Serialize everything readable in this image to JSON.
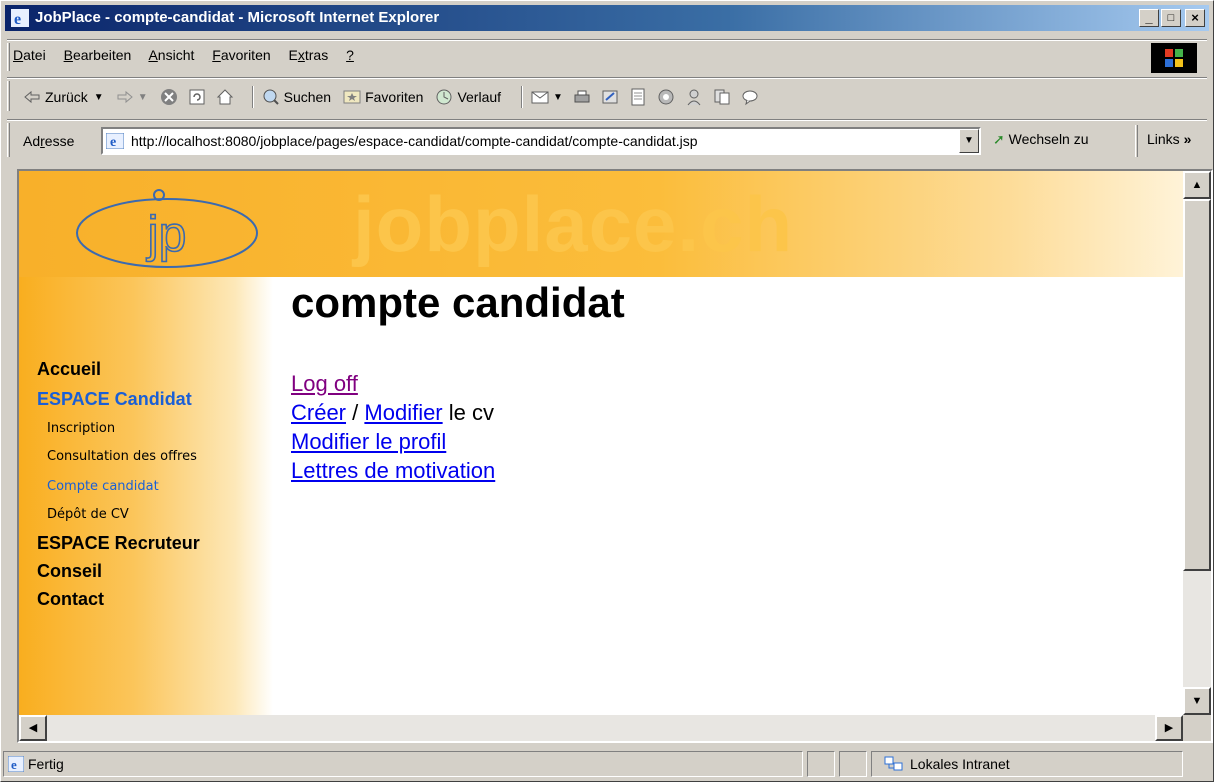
{
  "window": {
    "title": "JobPlace - compte-candidat - Microsoft Internet Explorer",
    "minimize": "_",
    "maximize": "□",
    "close": "×"
  },
  "menu": {
    "items": [
      {
        "label": "Datei",
        "u": "D",
        "rest": "atei"
      },
      {
        "label": "Bearbeiten",
        "u": "B",
        "rest": "earbeiten"
      },
      {
        "label": "Ansicht",
        "u": "A",
        "rest": "nsicht"
      },
      {
        "label": "Favoriten",
        "u": "F",
        "rest": "avoriten"
      },
      {
        "label": "Extras",
        "u": "x",
        "pre": "E",
        "rest": "tras"
      },
      {
        "label": "?",
        "u": "?",
        "rest": ""
      }
    ]
  },
  "toolbar": {
    "back": "Zurück",
    "search": "Suchen",
    "favorites": "Favoriten",
    "history": "Verlauf"
  },
  "address": {
    "label_pre": "Ad",
    "label_u": "r",
    "label_post": "esse",
    "url": "http://localhost:8080/jobplace/pages/espace-candidat/compte-candidat/compte-candidat.jsp",
    "goto": "Wechseln zu",
    "links": "Links"
  },
  "page": {
    "brand": "jobplace.ch",
    "logo_text": "jp",
    "title": "compte candidat",
    "nav": [
      {
        "label": "Accueil"
      },
      {
        "label": "ESPACE Candidat"
      },
      {
        "label": "ESPACE Recruteur"
      },
      {
        "label": "Conseil"
      },
      {
        "label": "Contact"
      }
    ],
    "subnav": [
      {
        "label": "Inscription"
      },
      {
        "label": "Consultation des offres"
      },
      {
        "label": "Compte candidat"
      },
      {
        "label": "Dépôt de CV"
      }
    ],
    "links": {
      "logoff": "Log off",
      "create": "Créer",
      "slash": "/",
      "modify": "Modifier",
      "cv_suffix": "le cv",
      "profile": "Modifier le profil",
      "letters": "Lettres de motivation"
    }
  },
  "status": {
    "text": "Fertig",
    "zone": "Lokales Intranet"
  },
  "colors": {
    "titlebar": "#0a246a",
    "banner_orange": "#f8b02a",
    "active_nav": "#1a5fd6",
    "link": "#0000ee",
    "visited_link": "#800080"
  }
}
